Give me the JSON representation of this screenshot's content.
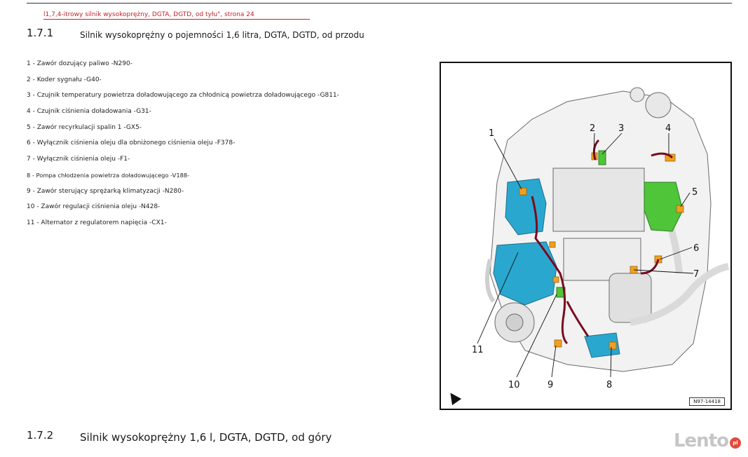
{
  "header": {
    "ref_link": "l1,7,4-itrowy silnik wysokoprężny, DGTA, DGTD, od tyłu\", strona 24"
  },
  "section_1": {
    "number": "1.7.1",
    "title": "Silnik wysokoprężny o pojemności 1,6 litra, DGTA, DGTD, od przodu"
  },
  "legend": [
    "1 - Zawór dozujący paliwo -N290-",
    "2 - Koder sygnału -G40-",
    "3 - Czujnik temperatury powietrza doładowującego za chłodnicą powietrza doładowującego -G811-",
    "4 - Czujnik ciśnienia doładowania -G31-",
    "5 - Zawór recyrkulacji spalin 1 -GX5-",
    "6 - Wyłącznik ciśnienia oleju dla obniżonego ciśnienia oleju -F378-",
    "7 - Wyłącznik ciśnienia oleju -F1-",
    "8 - Pompa chłodzenia powietrza doładowującego -V188-",
    "9 - Zawór sterujący sprężarką klimatyzacji -N280-",
    "10 - Zawór regulacji ciśnienia oleju -N428-",
    "11 - Alternator z regulatorem napięcia -CX1-"
  ],
  "figure": {
    "code": "N97-14418",
    "callouts": [
      "1",
      "2",
      "3",
      "4",
      "5",
      "6",
      "7",
      "8",
      "9",
      "10",
      "11"
    ],
    "colors": {
      "component_blue": "#2aa7cf",
      "component_green": "#4fc53a",
      "connector_orange": "#f0a020",
      "wire_red": "#7a0a1e"
    }
  },
  "section_2": {
    "number": "1.7.2",
    "title": "Silnik wysokoprężny 1,6 l, DGTA, DGTD, od góry"
  },
  "watermark": {
    "text": "Lento",
    "badge": "pl"
  }
}
